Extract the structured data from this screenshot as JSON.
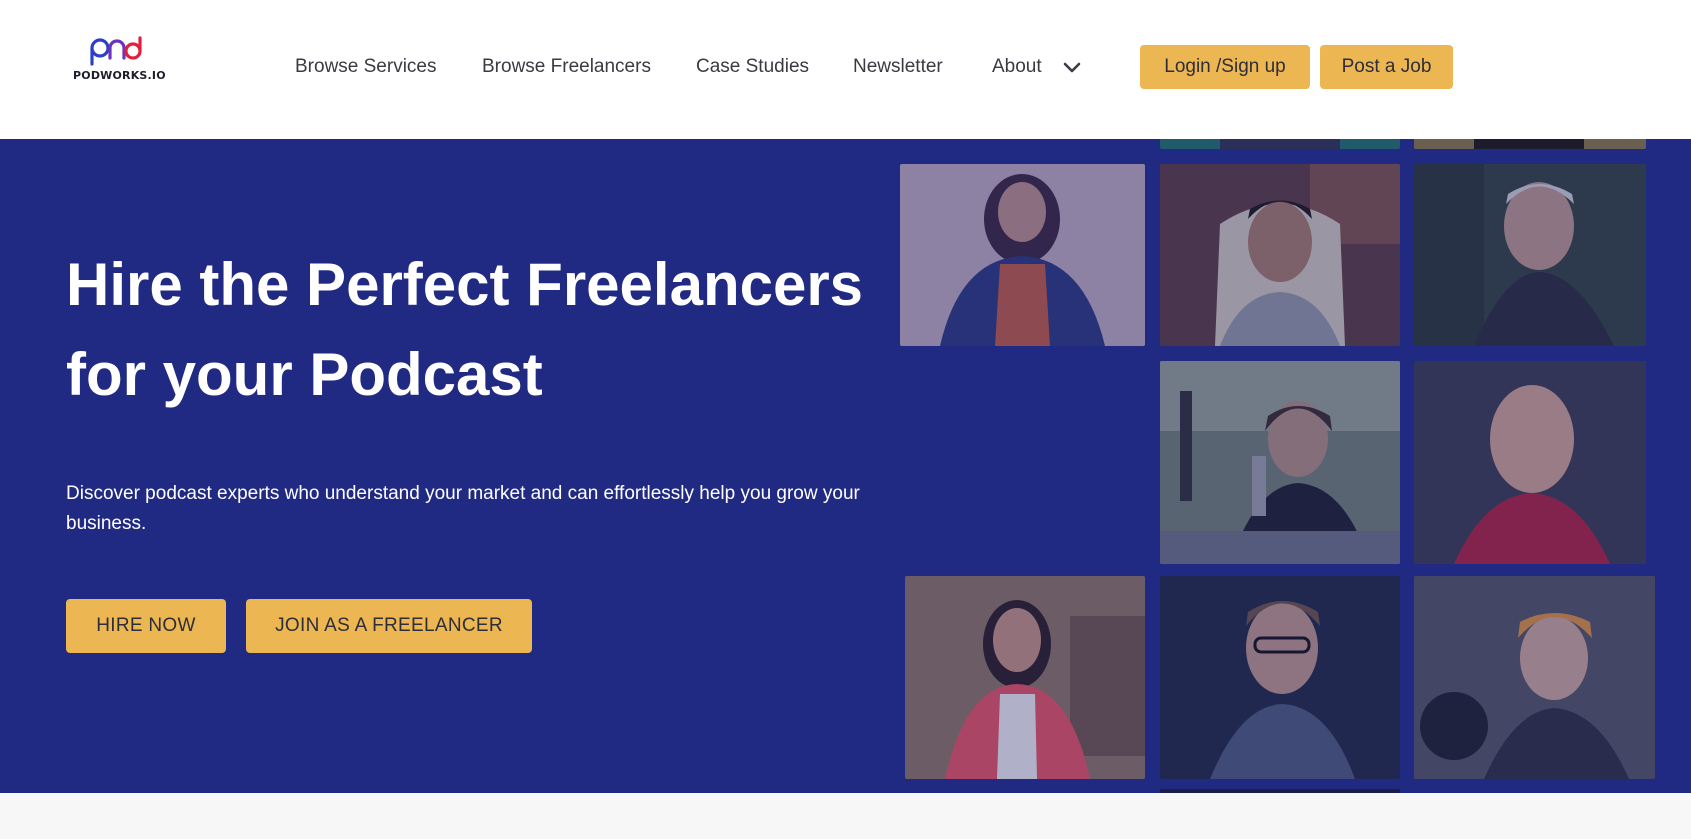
{
  "brand": {
    "logo_text": "PODWORKS.IO",
    "logo_colors": {
      "blue": "#2d3fc7",
      "red": "#e0203c"
    }
  },
  "nav": {
    "items": [
      {
        "label": "Browse Services"
      },
      {
        "label": "Browse Freelancers"
      },
      {
        "label": "Case Studies"
      },
      {
        "label": "Newsletter"
      },
      {
        "label": "About",
        "icon": "chevron-down-icon"
      }
    ],
    "login_label": "Login /Sign up",
    "post_job_label": "Post a Job"
  },
  "hero": {
    "title_line1": "Hire the Perfect Freelancers",
    "title_line2": "for your Podcast",
    "subtitle": "Discover podcast experts who understand your market and can effortlessly help you grow your business.",
    "hire_label": "HIRE NOW",
    "join_label": "JOIN AS A FREELANCER",
    "photo_count": 8
  },
  "colors": {
    "hero_background": "#212a82",
    "button_accent": "#ecb652",
    "button_text": "#2e2e38",
    "nav_text": "#3a3a44",
    "footer_strip": "#f7f7f7"
  }
}
